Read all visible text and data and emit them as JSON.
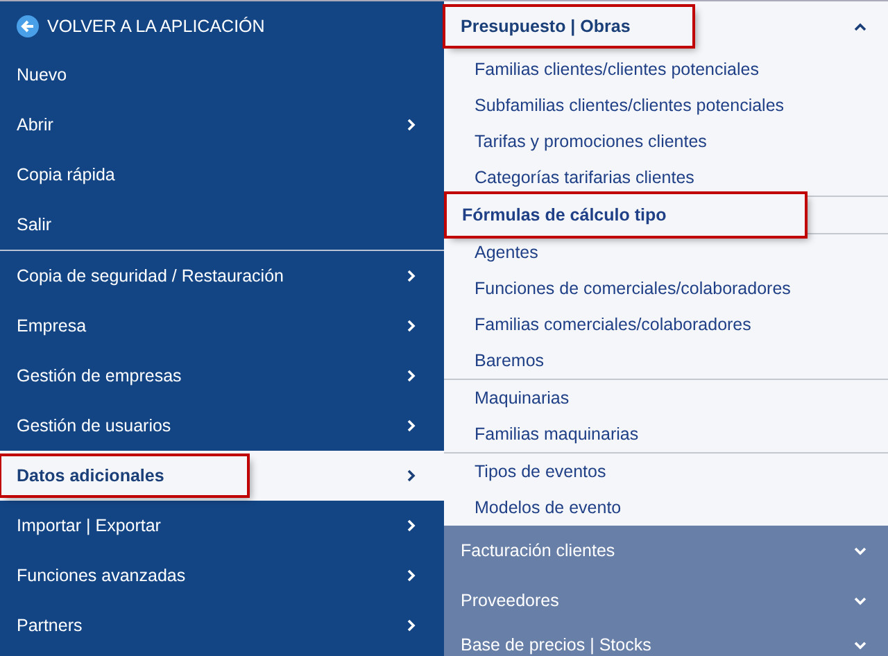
{
  "left_menu": {
    "back_link": {
      "label": "VOLVER A LA APLICACIÓN"
    },
    "groups": [
      [
        {
          "label": "Nuevo",
          "has_submenu": false,
          "selected": false,
          "highlighted": false
        },
        {
          "label": "Abrir",
          "has_submenu": true,
          "selected": false,
          "highlighted": false
        },
        {
          "label": "Copia rápida",
          "has_submenu": false,
          "selected": false,
          "highlighted": false
        },
        {
          "label": "Salir",
          "has_submenu": false,
          "selected": false,
          "highlighted": false
        }
      ],
      [
        {
          "label": "Copia de seguridad / Restauración",
          "has_submenu": true,
          "selected": false,
          "highlighted": false
        },
        {
          "label": "Empresa",
          "has_submenu": true,
          "selected": false,
          "highlighted": false
        },
        {
          "label": "Gestión de empresas",
          "has_submenu": true,
          "selected": false,
          "highlighted": false
        },
        {
          "label": "Gestión de usuarios",
          "has_submenu": true,
          "selected": false,
          "highlighted": false
        },
        {
          "label": "Datos adicionales",
          "has_submenu": true,
          "selected": true,
          "highlighted": true
        },
        {
          "label": "Importar | Exportar",
          "has_submenu": true,
          "selected": false,
          "highlighted": false
        },
        {
          "label": "Funciones avanzadas",
          "has_submenu": true,
          "selected": false,
          "highlighted": false
        },
        {
          "label": "Partners",
          "has_submenu": true,
          "selected": false,
          "highlighted": false
        }
      ]
    ]
  },
  "submenu": {
    "sections": [
      {
        "title": "Presupuesto | Obras",
        "expanded": true,
        "highlighted": true,
        "groups": [
          [
            {
              "label": "Familias clientes/clientes potenciales",
              "selected": false,
              "highlighted": false
            },
            {
              "label": "Subfamilias clientes/clientes potenciales",
              "selected": false,
              "highlighted": false
            },
            {
              "label": "Tarifas y promociones clientes",
              "selected": false,
              "highlighted": false
            },
            {
              "label": "Categorías tarifarias clientes",
              "selected": false,
              "highlighted": false
            }
          ],
          [
            {
              "label": "Fórmulas de cálculo tipo",
              "selected": true,
              "highlighted": true
            }
          ],
          [
            {
              "label": "Agentes",
              "selected": false,
              "highlighted": false
            },
            {
              "label": "Funciones de comerciales/colaboradores",
              "selected": false,
              "highlighted": false
            },
            {
              "label": "Familias comerciales/colaboradores",
              "selected": false,
              "highlighted": false
            },
            {
              "label": "Baremos",
              "selected": false,
              "highlighted": false
            }
          ],
          [
            {
              "label": "Maquinarias",
              "selected": false,
              "highlighted": false
            },
            {
              "label": "Familias maquinarias",
              "selected": false,
              "highlighted": false
            }
          ],
          [
            {
              "label": "Tipos de eventos",
              "selected": false,
              "highlighted": false
            },
            {
              "label": "Modelos de evento",
              "selected": false,
              "highlighted": false
            }
          ]
        ]
      },
      {
        "title": "Facturación clientes",
        "expanded": false,
        "highlighted": false
      },
      {
        "title": "Proveedores",
        "expanded": false,
        "highlighted": false
      },
      {
        "title": "Base de precios | Stocks",
        "expanded": false,
        "highlighted": false
      }
    ]
  }
}
